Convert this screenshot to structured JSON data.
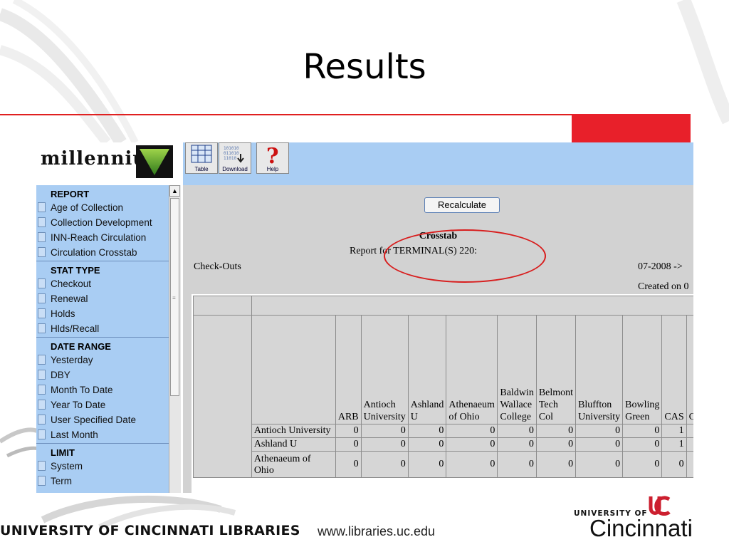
{
  "slide": {
    "title": "Results"
  },
  "app": {
    "logo_text": "millennium",
    "toolbar": {
      "table_label": "Table",
      "download_label": "Download",
      "help_label": "Help"
    }
  },
  "sidebar": {
    "sections": [
      {
        "title": "REPORT",
        "items": [
          "Age of Collection",
          "Collection Development",
          "INN-Reach Circulation",
          "Circulation Crosstab"
        ]
      },
      {
        "title": "STAT TYPE",
        "items": [
          "Checkout",
          "Renewal",
          "Holds",
          "Hlds/Recall"
        ]
      },
      {
        "title": "DATE RANGE",
        "items": [
          "Yesterday",
          "DBY",
          "Month To Date",
          "Year To Date",
          "User Specified Date",
          "Last Month"
        ]
      },
      {
        "title": "LIMIT",
        "items": [
          "System",
          "Term"
        ]
      }
    ]
  },
  "report": {
    "recalculate_label": "Recalculate",
    "title": "Crosstab",
    "subtitle": "Report for TERMINAL(S) 220:",
    "stat_label": "Check-Outs",
    "date_range": "07-2008 ->",
    "created": "Created on 0"
  },
  "table": {
    "columns": [
      "ARB",
      "Antioch University",
      "Ashland U",
      "Athenaeum of Ohio",
      "Baldwin Wallace College",
      "Belmont Tech Col",
      "Bluffton University",
      "Bowling Green",
      "CAS",
      "C"
    ],
    "rows": [
      {
        "label": "Antioch University",
        "values": [
          "0",
          "0",
          "0",
          "0",
          "0",
          "0",
          "0",
          "0",
          "1",
          ""
        ]
      },
      {
        "label": "Ashland U",
        "values": [
          "0",
          "0",
          "0",
          "0",
          "0",
          "0",
          "0",
          "0",
          "1",
          ""
        ]
      },
      {
        "label": "Athenaeum of Ohio",
        "values": [
          "0",
          "0",
          "0",
          "0",
          "0",
          "0",
          "0",
          "0",
          "0",
          ""
        ]
      }
    ]
  },
  "footer": {
    "org": "UNIVERSITY OF CINCINNATI LIBRARIES",
    "url": "www.libraries.uc.edu",
    "uc_small": "UNIVERSITY OF",
    "uc_big": "Cincinnati"
  },
  "colors": {
    "accent_red": "#e8202a",
    "toolbar_blue": "#a9cdf3",
    "highlight_oval": "#d81e1e"
  }
}
